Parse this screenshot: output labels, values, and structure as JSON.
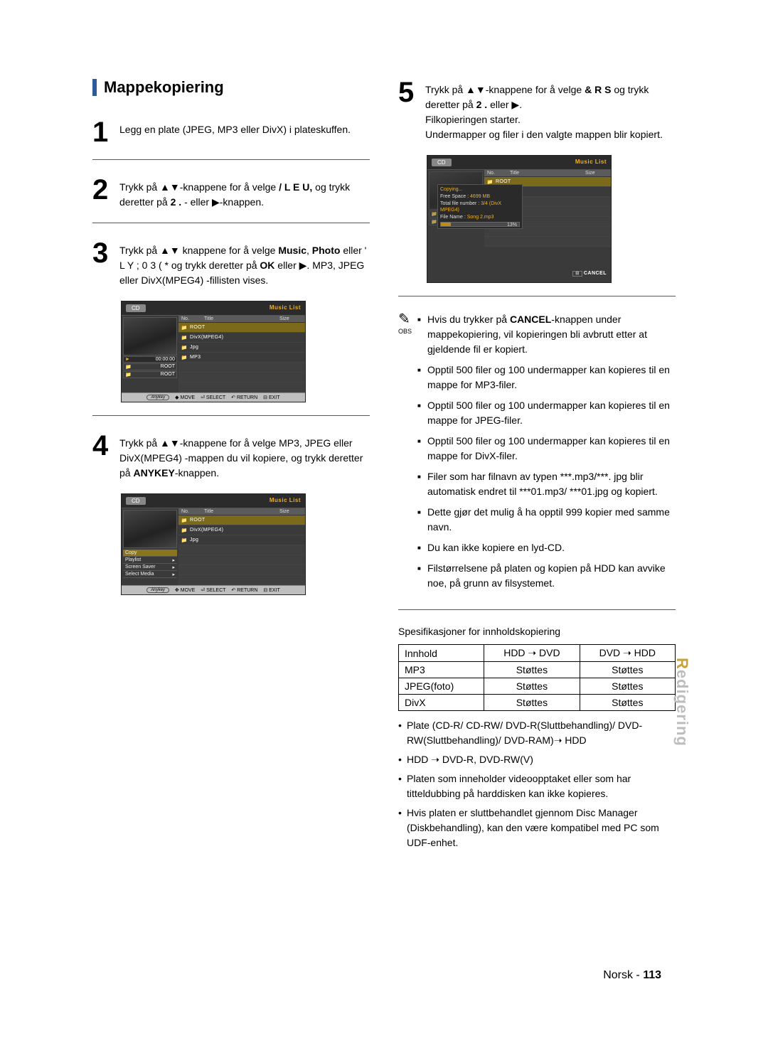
{
  "section_title": "Mappekopiering",
  "steps": {
    "s1": {
      "num": "1",
      "text": "Legg en plate (JPEG, MP3 eller DivX) i plateskuffen."
    },
    "s2": {
      "num": "2",
      "text_a": "Trykk på ▲▼-knappene for å velge ",
      "b1": "/ L E U,",
      "text_b": " og trykk deretter på ",
      "b2": "2 .",
      "text_c": "- eller ▶-knappen."
    },
    "s3": {
      "num": "3",
      "text_a": "Trykk på ▲▼ knappene for å velge ",
      "b1": "Music",
      "comma": ", ",
      "b2": "Photo",
      "text_b": " eller ' L Y ; 0 3 ( * og trykk deretter på ",
      "b3": "OK",
      "text_c": " eller ▶. MP3, JPEG eller DivX(MPEG4) -fillisten vises."
    },
    "s4": {
      "num": "4",
      "text_a": "Trykk på ▲▼-knappene for å velge MP3, JPEG eller DivX(MPEG4) -mappen du vil kopiere, og trykk deretter på ",
      "b1": "ANYKEY",
      "text_b": "-knappen."
    },
    "s5": {
      "num": "5",
      "text_a": "Trykk på ▲▼-knappene for å velge ",
      "b1": "& R S",
      "text_b": " og trykk deretter på ",
      "b2": "2 .",
      "text_c": " eller ▶.",
      "line2": "Filkopieringen starter.",
      "line3": "Undermapper og filer i den valgte mappen blir kopiert."
    }
  },
  "shot": {
    "tab": "CD",
    "music_list": "Music List",
    "th_no": "No.",
    "th_title": "Title",
    "th_size": "Size",
    "rows": [
      "ROOT",
      "DivX(MPEG4)",
      "Jpg",
      "MP3"
    ],
    "left_play": "►",
    "left_time": "00:00:00",
    "left_root": "ROOT",
    "foot_anykey": "Anykey",
    "foot_move": "MOVE",
    "foot_select": "SELECT",
    "foot_return": "RETURN",
    "foot_exit": "EXIT",
    "menu": [
      "Copy",
      "Playlist",
      "Screen Saver",
      "Select Media"
    ],
    "copybox": {
      "title": "Copying...",
      "free": "Free Space :",
      "free_v": "4699 MB",
      "num": "Total file number :",
      "num_v": "3/4 (DivX MPEG4)",
      "name": "File Name :",
      "name_v": "Song 2.mp3",
      "pct": "13%"
    },
    "cancel": "CANCEL"
  },
  "obs_label": "OBS",
  "notes": [
    {
      "a": "Hvis du trykker på ",
      "b": "CANCEL",
      "c": "-knappen under mappekopiering, vil kopieringen bli avbrutt etter at gjeldende fil er kopiert."
    },
    {
      "a": "Opptil 500 filer og 100 undermapper kan kopieres til en mappe for MP3-filer."
    },
    {
      "a": "Opptil 500 filer og 100 undermapper kan kopieres til en mappe for JPEG-filer."
    },
    {
      "a": "Opptil 500 filer og 100 undermapper kan kopieres til en mappe for DivX-filer."
    },
    {
      "a": "Filer som har filnavn av typen ***.mp3/***. jpg blir automatisk endret til ***01.mp3/ ***01.jpg og kopiert."
    },
    {
      "a": "Dette gjør det mulig å ha opptil 999 kopier med samme navn."
    },
    {
      "a": "Du kan ikke kopiere en lyd-CD."
    },
    {
      "a": "Filstørrelsene på platen og kopien på HDD kan avvike noe, på grunn av filsystemet."
    }
  ],
  "spec_title": "Spesifikasjoner for innholdskopiering",
  "spec": {
    "h1": "Innhold",
    "h2": "HDD ➝ DVD",
    "h3": "DVD ➝ HDD",
    "r1c1": "MP3",
    "r1c2": "Støttes",
    "r1c3": "Støttes",
    "r2c1": "JPEG(foto)",
    "r2c2": "Støttes",
    "r2c3": "Støttes",
    "r3c1": "DivX",
    "r3c2": "Støttes",
    "r3c3": "Støttes"
  },
  "dots": [
    "Plate (CD-R/ CD-RW/ DVD-R(Sluttbehandling)/ DVD-RW(Sluttbehandling)/ DVD-RAM)➝ HDD",
    "HDD ➝ DVD-R, DVD-RW(V)",
    "Platen som inneholder videoopptaket eller som har titteldubbing på harddisken kan ikke kopieres.",
    "Hvis platen er sluttbehandlet gjennom Disc Manager (Diskbehandling), kan den være kompatibel med PC som UDF-enhet."
  ],
  "side_tab": "Redigering",
  "footer_lang": "Norsk - ",
  "footer_page": "113"
}
